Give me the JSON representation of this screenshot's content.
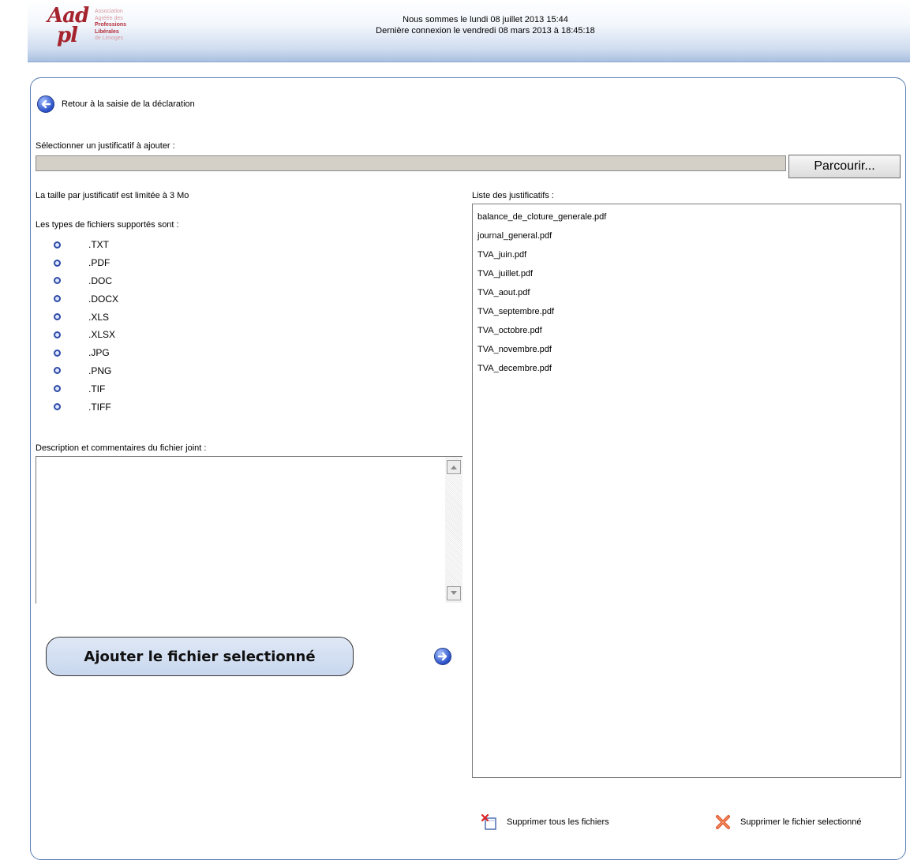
{
  "header": {
    "logo_mark": [
      "Aad",
      "pl"
    ],
    "logo_lines": [
      "Association",
      "Agréée des",
      "Professions",
      "Libérales",
      "de Limoges"
    ],
    "line1": "Nous sommes le lundi 08 juillet 2013 15:44",
    "line2": "Dernière connexion le vendredi 08 mars 2013 à 18:45:18"
  },
  "back_label": "Retour à la saisie de la déclaration",
  "select_label": "Sélectionner un justificatif à ajouter :",
  "file_input_value": "",
  "browse_label": "Parcourir...",
  "size_limit": "La taille par justificatif est limitée à 3 Mo",
  "types_label": "Les types de fichiers supportés sont :",
  "types": [
    ".TXT",
    ".PDF",
    ".DOC",
    ".DOCX",
    ".XLS",
    ".XLSX",
    ".JPG",
    ".PNG",
    ".TIF",
    ".TIFF"
  ],
  "description_label": "Description et commentaires du fichier joint :",
  "description_value": "",
  "add_button": "Ajouter le fichier selectionné",
  "list_label": "Liste des justificatifs :",
  "files": [
    "balance_de_cloture_generale.pdf",
    "journal_general.pdf",
    "TVA_juin.pdf",
    "TVA_juillet.pdf",
    "TVA_aout.pdf",
    "TVA_septembre.pdf",
    "TVA_octobre.pdf",
    "TVA_novembre.pdf",
    "TVA_decembre.pdf"
  ],
  "delete_all": "Supprimer tous les fichiers",
  "delete_selected": "Supprimer le fichier selectionné",
  "colors": {
    "accent": "#5b7fb5",
    "brand": "#a5232d",
    "button_bg": "#c8d7ee"
  },
  "icons": [
    "back-arrow-icon",
    "forward-arrow-icon",
    "delete-all-icon",
    "delete-selected-icon"
  ]
}
